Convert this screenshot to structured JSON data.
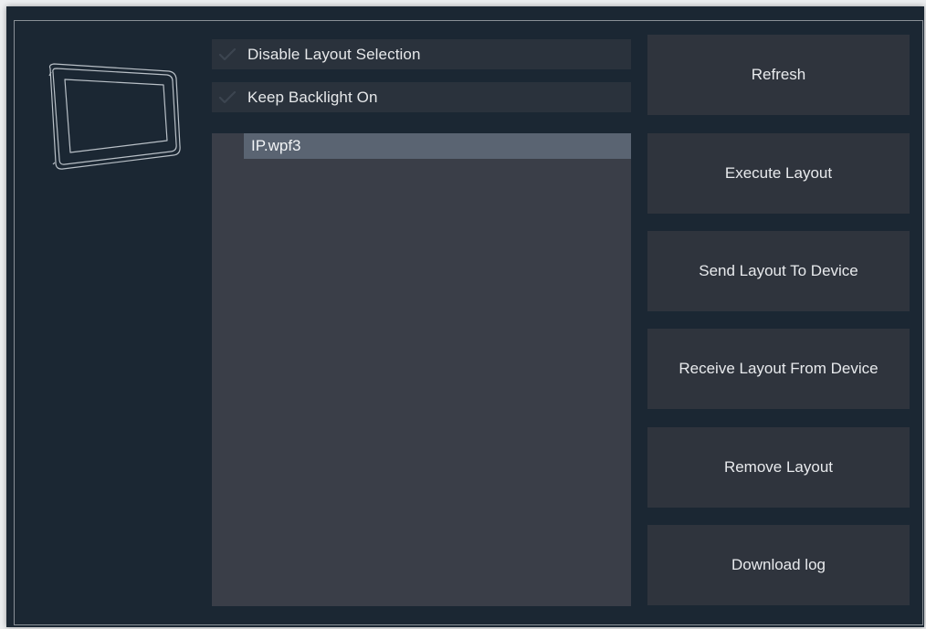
{
  "options": {
    "disable_layout_selection": {
      "label": "Disable Layout Selection",
      "checked": true
    },
    "keep_backlight_on": {
      "label": "Keep Backlight On",
      "checked": true
    }
  },
  "layouts": {
    "items": [
      {
        "name": "IP.wpf3",
        "selected": true
      }
    ]
  },
  "actions": {
    "refresh": "Refresh",
    "execute_layout": "Execute Layout",
    "send_layout_to_device": "Send Layout To Device",
    "receive_layout_from_device": "Receive Layout From Device",
    "remove_layout": "Remove Layout",
    "download_log": "Download log"
  },
  "icons": {
    "device": "tablet-outline-icon",
    "check": "checkmark-icon"
  },
  "colors": {
    "panel_background": "#1b2733",
    "button_background": "#2f343d",
    "list_background": "#3a3e48",
    "selected_item": "#5a6472"
  }
}
